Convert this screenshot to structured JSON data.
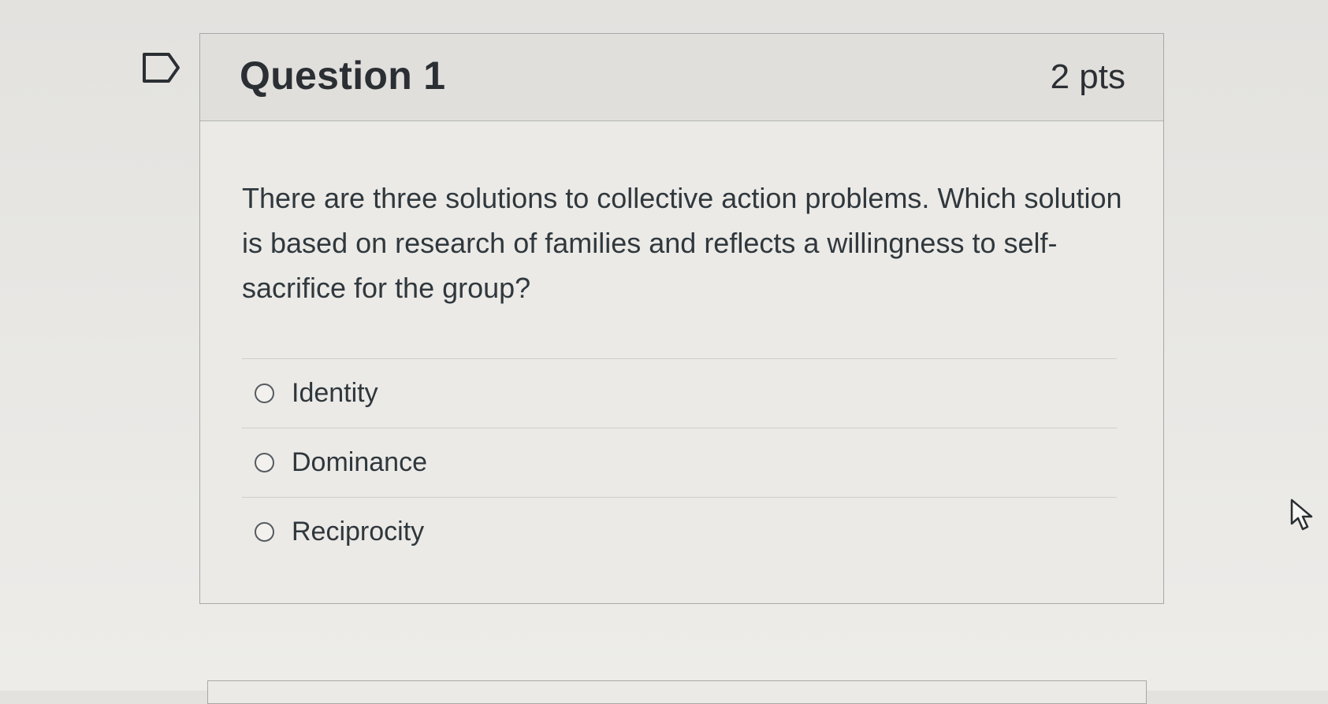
{
  "question": {
    "title": "Question 1",
    "points": "2 pts",
    "text": "There are three solutions to collective action problems. Which solution is based on research of families and reflects a willingness to self-sacrifice for the group?",
    "answers": [
      {
        "label": "Identity",
        "selected": false
      },
      {
        "label": "Dominance",
        "selected": false
      },
      {
        "label": "Reciprocity",
        "selected": false
      }
    ]
  },
  "icons": {
    "flag": "bookmark-flag-icon",
    "cursor": "mouse-pointer-icon"
  },
  "colors": {
    "text": "#2d3b45",
    "header_bg": "#e0dfdc",
    "border": "#a8a8a6"
  }
}
